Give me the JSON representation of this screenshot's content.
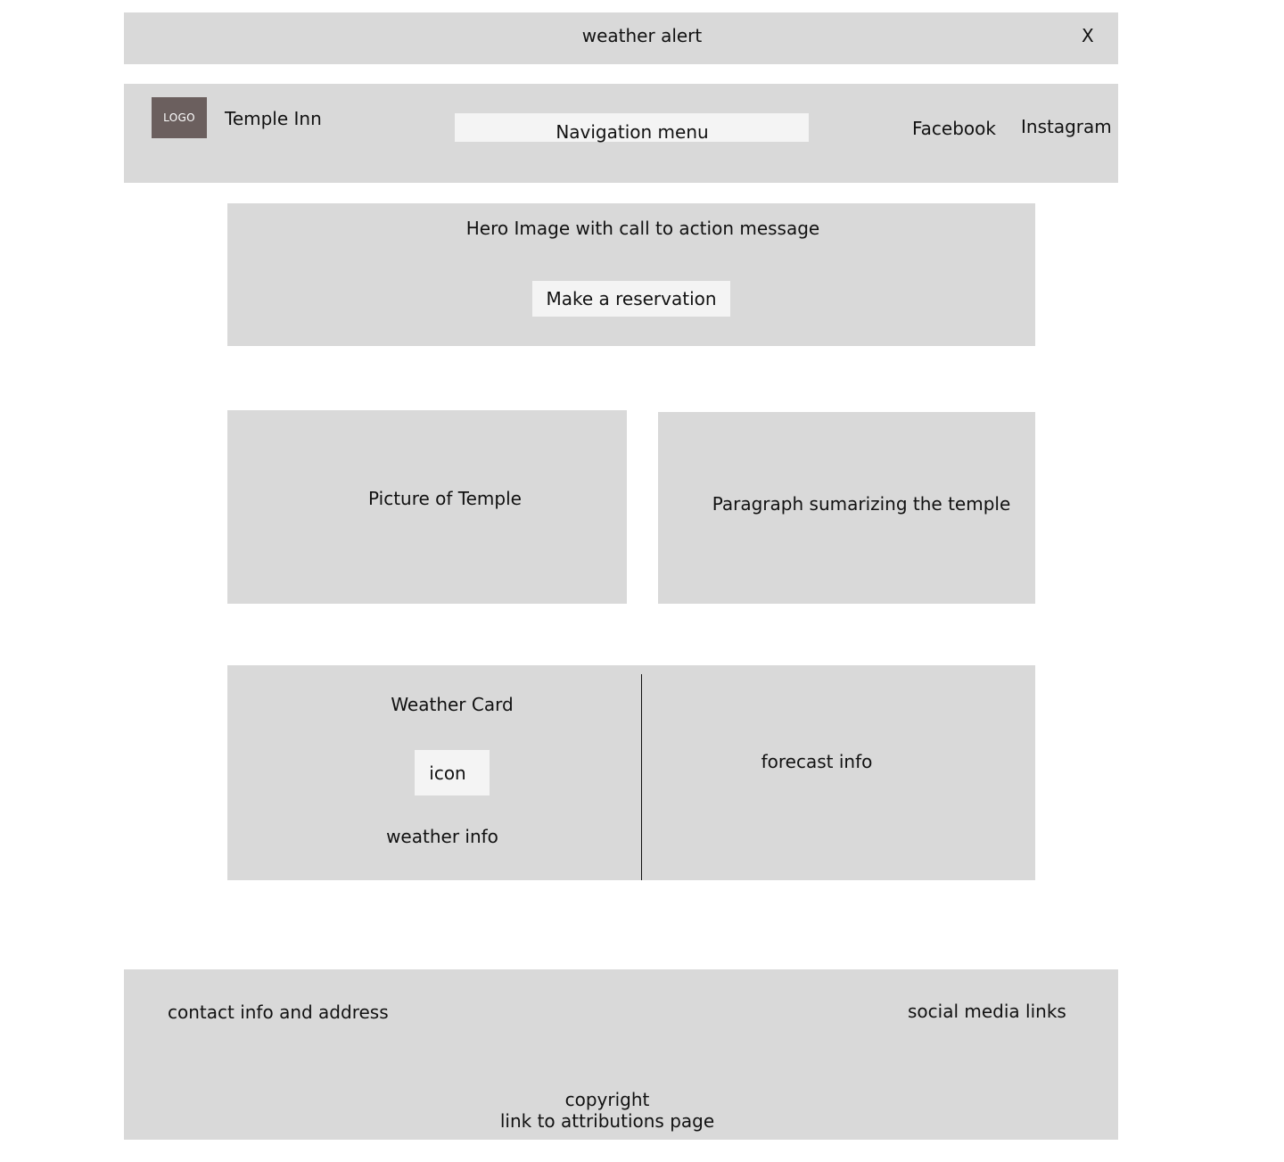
{
  "alert": {
    "text": "weather alert",
    "close_label": "X"
  },
  "header": {
    "logo_text": "LOGO",
    "brand_name": "Temple Inn",
    "nav_label": "Navigation menu",
    "social": [
      "Facebook",
      "Instagram"
    ]
  },
  "hero": {
    "text": "Hero Image with call to action message",
    "button_label": "Make a reservation"
  },
  "temple": {
    "picture_label": "Picture of Temple",
    "paragraph_label": "Paragraph sumarizing the temple"
  },
  "weather": {
    "card_title": "Weather Card",
    "icon_label": "icon",
    "info_label": "weather info",
    "forecast_label": "forecast info"
  },
  "footer": {
    "contact": "contact info and address",
    "social": "social media links",
    "copyright": "copyright",
    "attribution": "link to attributions page"
  }
}
